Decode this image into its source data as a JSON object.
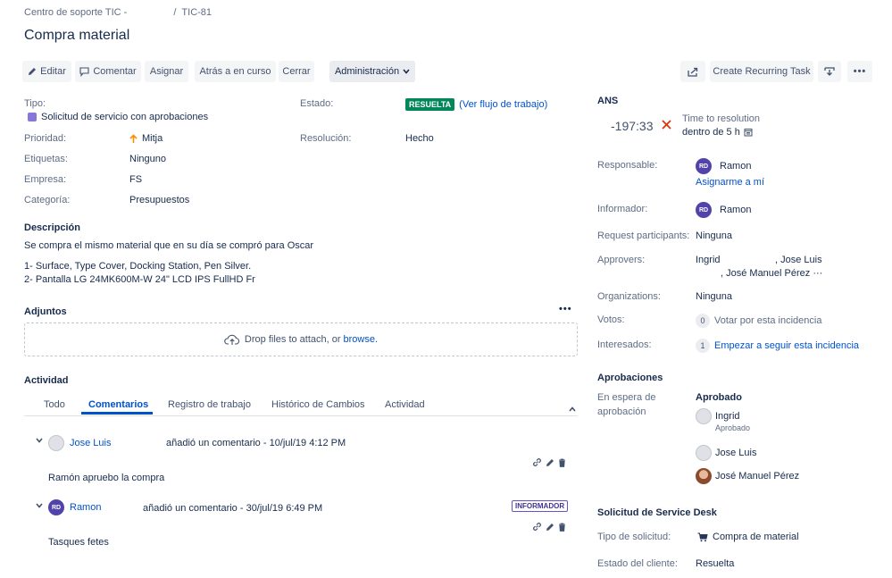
{
  "breadcrumb": {
    "project": "Centro de soporte TIC -",
    "separator": "/",
    "issue_key": "TIC-81"
  },
  "title": "Compra material",
  "toolbar": {
    "edit": "Editar",
    "comment": "Comentar",
    "assign": "Asignar",
    "back": "Atrás a en curso",
    "close": "Cerrar",
    "admin": "Administración",
    "recurring": "Create Recurring Task"
  },
  "details": {
    "type_label": "Tipo:",
    "type_value": "Solicitud de servicio con aprobaciones",
    "status_label": "Estado:",
    "status_value": "RESUELTA",
    "workflow_link": "(Ver flujo de trabajo)",
    "priority_label": "Prioridad:",
    "priority_value": "Mitja",
    "resolution_label": "Resolución:",
    "resolution_value": "Hecho",
    "labels_label": "Etiquetas:",
    "labels_value": "Ninguno",
    "company_label": "Empresa:",
    "company_value": "FS",
    "category_label": "Categoría:",
    "category_value": "Presupuestos"
  },
  "description": {
    "heading": "Descripción",
    "line1": "Se compra el mismo material que en su día se compró para Oscar",
    "line2": "1- Surface, Type Cover, Docking Station, Pen Silver.",
    "line3": "2- Pantalla LG 24MK600M-W 24\" LCD IPS FullHD Fr"
  },
  "attachments": {
    "heading": "Adjuntos",
    "drop_text": "Drop files to attach, or",
    "browse": "browse."
  },
  "activity": {
    "heading": "Actividad",
    "tabs": [
      "Todo",
      "Comentarios",
      "Registro de trabajo",
      "Histórico de Cambios",
      "Actividad"
    ],
    "active_tab": "Comentarios",
    "comments": [
      {
        "author": "Jose Luis",
        "meta": "añadió un comentario - 10/jul/19 4:12 PM",
        "body": "Ramón apruebo la compra",
        "tag": ""
      },
      {
        "author": "Ramon",
        "initials": "RD",
        "meta": "añadió un comentario - 30/jul/19 6:49 PM",
        "body": "Tasques fetes",
        "tag": "INFORMADOR"
      }
    ]
  },
  "sla": {
    "heading": "ANS",
    "value": "-197:33",
    "target": "Time to resolution",
    "within": "dentro de 5 h"
  },
  "people": {
    "assignee_label": "Responsable:",
    "assignee": "Ramon",
    "assignee_initials": "RD",
    "assign_me": "Asignarme a mí",
    "reporter_label": "Informador:",
    "reporter": "Ramon",
    "reporter_initials": "RD",
    "participants_label": "Request participants:",
    "participants": "Ninguna",
    "approvers_label": "Approvers:",
    "approvers_line1a": "Ingrid",
    "approvers_line1b": ", Jose Luis",
    "approvers_line2": ", José Manuel Pérez ···",
    "orgs_label": "Organizations:",
    "orgs": "Ninguna",
    "votes_label": "Votos:",
    "votes_count": "0",
    "votes_text": "Votar por esta incidencia",
    "watchers_label": "Interesados:",
    "watchers_count": "1",
    "watchers_text": "Empezar a seguir esta incidencia"
  },
  "approvals": {
    "heading": "Aprobaciones",
    "waiting_line1": "En espera de",
    "waiting_line2": "aprobación",
    "status": "Aprobado",
    "approver1": "Ingrid",
    "approver1_state": "Aprobado",
    "approver2": "Jose Luis",
    "approver3": "José Manuel Pérez"
  },
  "service_desk": {
    "heading": "Solicitud de Service Desk",
    "type_label": "Tipo de solicitud:",
    "type_value": "Compra de material",
    "customer_status_label": "Estado del cliente:",
    "customer_status_value": "Resuelta"
  }
}
